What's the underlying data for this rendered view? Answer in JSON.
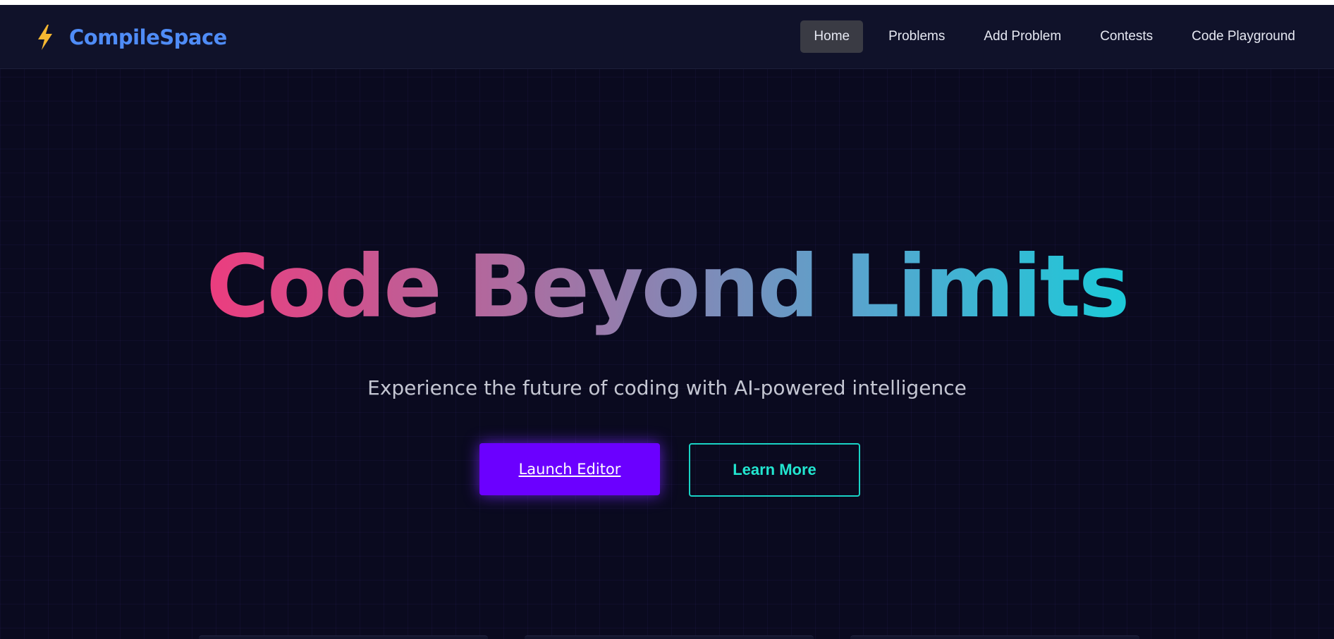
{
  "brand": {
    "name": "CompileSpace",
    "icon": "lightning-bolt-icon",
    "icon_color": "#f5b731",
    "name_color": "#4f8cf7"
  },
  "nav": {
    "items": [
      {
        "label": "Home",
        "active": true
      },
      {
        "label": "Problems",
        "active": false
      },
      {
        "label": "Add Problem",
        "active": false
      },
      {
        "label": "Contests",
        "active": false
      },
      {
        "label": "Code Playground",
        "active": false
      }
    ]
  },
  "hero": {
    "title": "Code Beyond Limits",
    "title_gradient": [
      "#ec3c7e",
      "#9b79a9",
      "#55a6cf",
      "#1ccad8"
    ],
    "subtitle": "Experience the future of coding with AI-powered intelligence",
    "primary_button": "Launch Editor",
    "secondary_button": "Learn More"
  },
  "colors": {
    "background": "#0a0a1f",
    "navbar": "#10122a",
    "primary_button": "#6b00ff",
    "secondary_button_accent": "#22e6d0"
  }
}
